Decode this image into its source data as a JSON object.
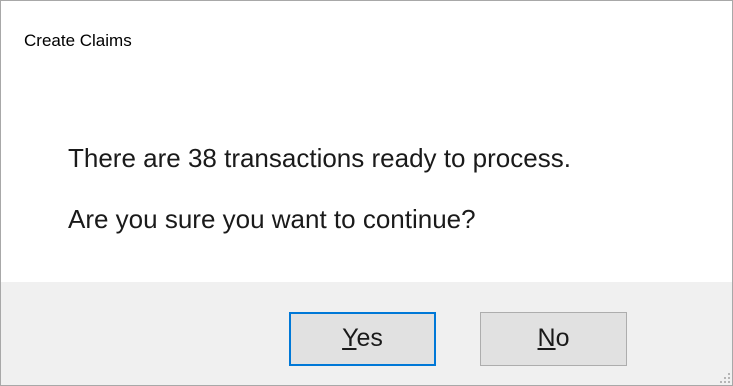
{
  "window": {
    "title": "Create Claims"
  },
  "message": {
    "line1": "There are 38 transactions ready to process.",
    "line2": "Are you sure you want to continue?"
  },
  "buttons": {
    "yes": {
      "accel": "Y",
      "rest": "es"
    },
    "no": {
      "accel": "N",
      "rest": "o"
    }
  },
  "colors": {
    "focus_border": "#0078d7",
    "footer_bg": "#f0f0f0",
    "button_bg": "#e1e1e1"
  }
}
